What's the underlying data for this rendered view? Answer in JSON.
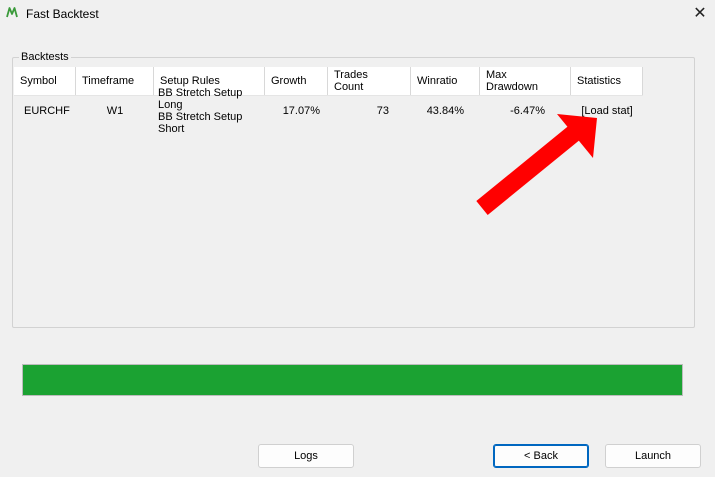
{
  "window": {
    "title": "Fast Backtest",
    "close_glyph": "✕",
    "app_icon": "mt-logo-icon"
  },
  "group": {
    "legend": "Backtests"
  },
  "table": {
    "columns": [
      "Symbol",
      "Timeframe",
      "Setup Rules",
      "Growth",
      [
        "Trades",
        "Count"
      ],
      "Winratio",
      [
        "Max",
        "Drawdown"
      ],
      "Statistics"
    ],
    "rows": [
      {
        "symbol": "EURCHF",
        "timeframe": "W1",
        "setup_rules": [
          "BB Stretch Setup Long",
          "BB Stretch Setup Short"
        ],
        "growth": "17.07%",
        "trades_count": "73",
        "winratio": "43.84%",
        "max_drawdown": "-6.47%",
        "statistics": "[Load stat]"
      }
    ]
  },
  "progress": {
    "value_percent": 100,
    "color": "#1ba232"
  },
  "buttons": {
    "logs": "Logs",
    "back": "< Back",
    "launch": "Launch"
  },
  "annotation": {
    "arrow_color": "#ff0000"
  }
}
